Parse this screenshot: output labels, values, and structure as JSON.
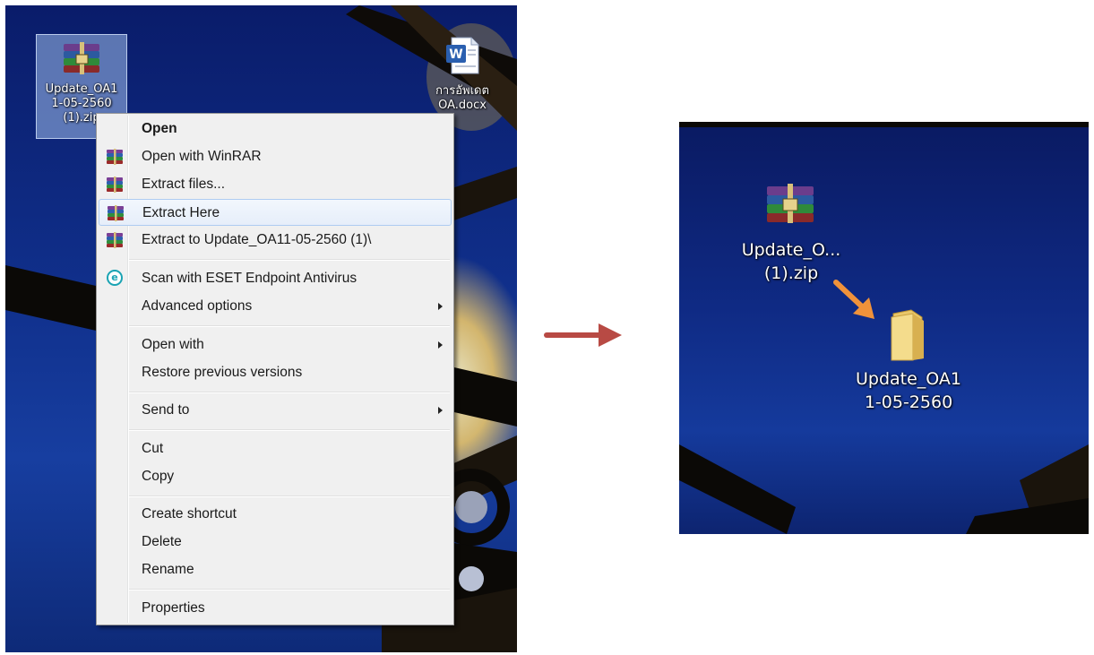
{
  "left_desktop": {
    "zip_icon_label": [
      "Update_OA1",
      "1-05-2560",
      "(1).zip"
    ],
    "docx_icon_label": [
      "การอัพเดต",
      "OA.docx"
    ]
  },
  "context_menu": {
    "items": [
      {
        "label": "Open",
        "bold": true,
        "icon": "none"
      },
      {
        "label": "Open with WinRAR",
        "icon": "winrar-icon"
      },
      {
        "label": "Extract files...",
        "icon": "winrar-icon"
      },
      {
        "label": "Extract Here",
        "icon": "winrar-icon",
        "highlighted": true
      },
      {
        "label": "Extract to Update_OA11-05-2560 (1)\\",
        "icon": "winrar-icon"
      },
      {
        "label": "Scan with ESET Endpoint Antivirus",
        "icon": "eset-icon"
      },
      {
        "label": "Advanced options",
        "submenu": true
      },
      {
        "label": "Open with",
        "submenu": true
      },
      {
        "label": "Restore previous versions"
      },
      {
        "label": "Send to",
        "submenu": true
      },
      {
        "label": "Cut"
      },
      {
        "label": "Copy"
      },
      {
        "label": "Create shortcut"
      },
      {
        "label": "Delete"
      },
      {
        "label": "Rename"
      },
      {
        "label": "Properties"
      }
    ]
  },
  "right_desktop": {
    "zip_icon_label": [
      "Update_O...",
      "(1).zip"
    ],
    "folder_icon_label": [
      "Update_OA1",
      "1-05-2560"
    ]
  },
  "colors": {
    "big_arrow": "#b84a44",
    "small_arrow": "#f0923a",
    "menu_bg": "#f0f0f0",
    "menu_highlight_border": "#aeccf1"
  }
}
